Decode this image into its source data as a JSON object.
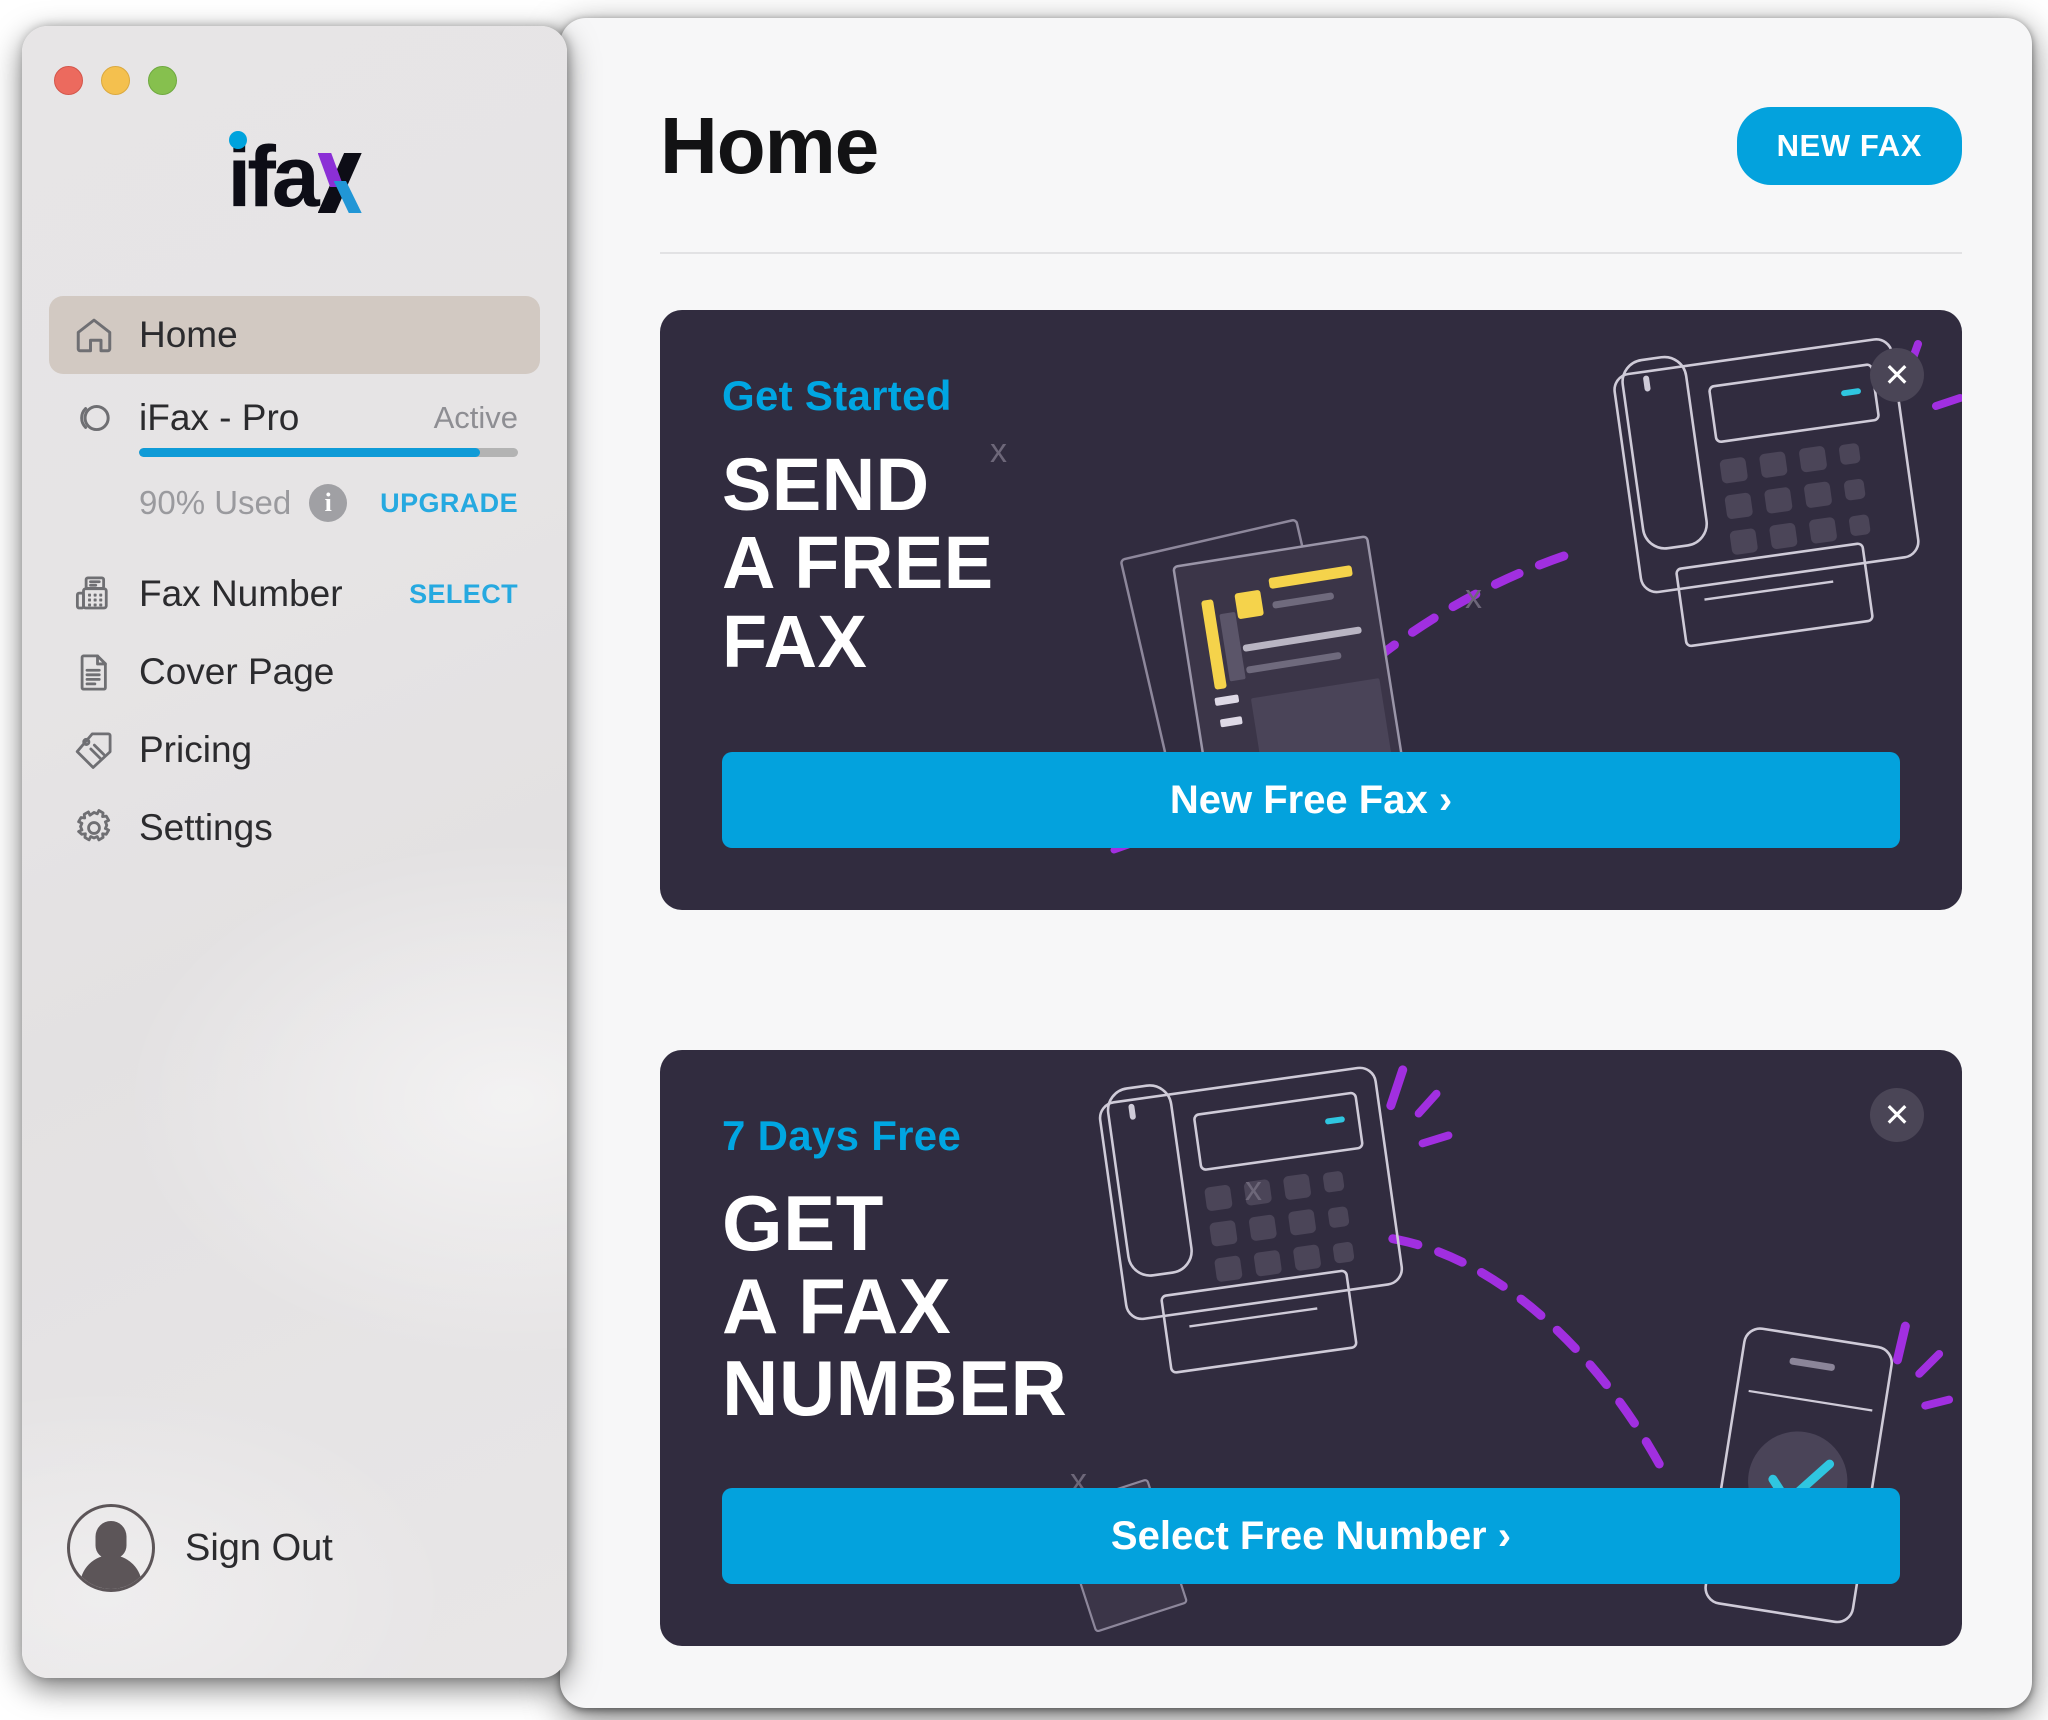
{
  "window": {
    "traffic_lights": [
      "close",
      "minimize",
      "maximize"
    ],
    "colors": {
      "accent_blue": "#03a2dd",
      "card_bg": "#312c3f",
      "sidebar_bg": "#e6e4e5",
      "active_nav_bg": "#d2c9c2",
      "purple": "#a12fe0",
      "yellow": "#f5d34b",
      "cyan_check": "#2fc6e0"
    }
  },
  "sidebar": {
    "logo": {
      "text": "ifax",
      "name": "ifax-logo"
    },
    "items": [
      {
        "label": "Home",
        "icon": "home-icon",
        "right": "",
        "right_kind": "none",
        "active": true
      },
      {
        "label": "iFax - Pro",
        "icon": "plan-icon",
        "right": "Active",
        "right_kind": "status",
        "active": false
      },
      {
        "label": "Fax Number",
        "icon": "fax-icon",
        "right": "SELECT",
        "right_kind": "link",
        "active": false
      },
      {
        "label": "Cover Page",
        "icon": "document-icon",
        "right": "",
        "right_kind": "none",
        "active": false
      },
      {
        "label": "Pricing",
        "icon": "price-tag-icon",
        "right": "",
        "right_kind": "none",
        "active": false
      },
      {
        "label": "Settings",
        "icon": "gear-icon",
        "right": "",
        "right_kind": "none",
        "active": false
      }
    ],
    "usage": {
      "percent": 90,
      "percent_label": "90% Used",
      "info_glyph": "i",
      "action_label": "UPGRADE"
    },
    "footer": {
      "signout_label": "Sign Out",
      "avatar": "user-avatar"
    }
  },
  "main": {
    "title": "Home",
    "new_fax_label": "NEW FAX",
    "cards": [
      {
        "eyebrow": "Get Started",
        "title_lines": [
          "SEND",
          "A FREE",
          "FAX"
        ],
        "cta_label": "New Free Fax ›",
        "close_glyph": "✕",
        "art": "documents-to-fax-machine"
      },
      {
        "eyebrow": "7 Days Free",
        "title_lines": [
          "GET",
          "A FAX",
          "NUMBER"
        ],
        "cta_label": "Select Free Number ›",
        "close_glyph": "✕",
        "art": "fax-machine-to-phone"
      }
    ]
  }
}
